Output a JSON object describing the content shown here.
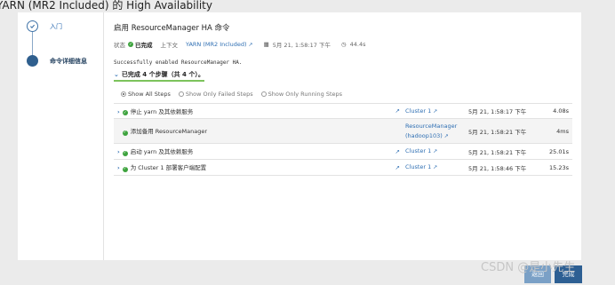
{
  "page_title": "YARN (MR2 Included) 的 High Availability",
  "steps": [
    {
      "label": "入门",
      "state": "done"
    },
    {
      "label": "命令详细信息",
      "state": "active"
    }
  ],
  "command": {
    "title": "启用 ResourceManager HA 命令",
    "status_label": "状态",
    "status_value": "已完成",
    "context_label": "上下文",
    "context_value": "YARN (MR2 Included)",
    "date": "5月 21, 1:58:17 下午",
    "duration": "44.4s",
    "message": "Successfully enabled ResourceManager HA.",
    "summary": "已完成 4 个步骤（共 4 个）。"
  },
  "filters": [
    {
      "label": "Show All Steps",
      "selected": true
    },
    {
      "label": "Show Only Failed Steps",
      "selected": false
    },
    {
      "label": "Show Only Running Steps",
      "selected": false
    }
  ],
  "rows": [
    {
      "name": "停止 yarn 及其依赖服务",
      "role": "Cluster 1",
      "time": "5月 21, 1:58:17 下午",
      "duration": "4.08s"
    },
    {
      "name": "添加备用 ResourceManager",
      "role": "ResourceManager (hadoop103)",
      "role_line1": "ResourceManager",
      "role_line2": "(hadoop103)",
      "time": "5月 21, 1:58:21 下午",
      "duration": "4ms"
    },
    {
      "name": "启动 yarn 及其依赖服务",
      "role": "Cluster 1",
      "time": "5月 21, 1:58:21 下午",
      "duration": "25.01s"
    },
    {
      "name": "为 Cluster 1 部署客户端配置",
      "role": "Cluster 1",
      "time": "5月 21, 1:58:46 下午",
      "duration": "15.23s"
    }
  ],
  "buttons": {
    "back": "返回",
    "finish": "完成"
  },
  "watermark": "CSDN @是小先生",
  "colors": {
    "accent": "#2f6fb3",
    "success": "#3da33d",
    "primary_button": "#2d5f93"
  }
}
